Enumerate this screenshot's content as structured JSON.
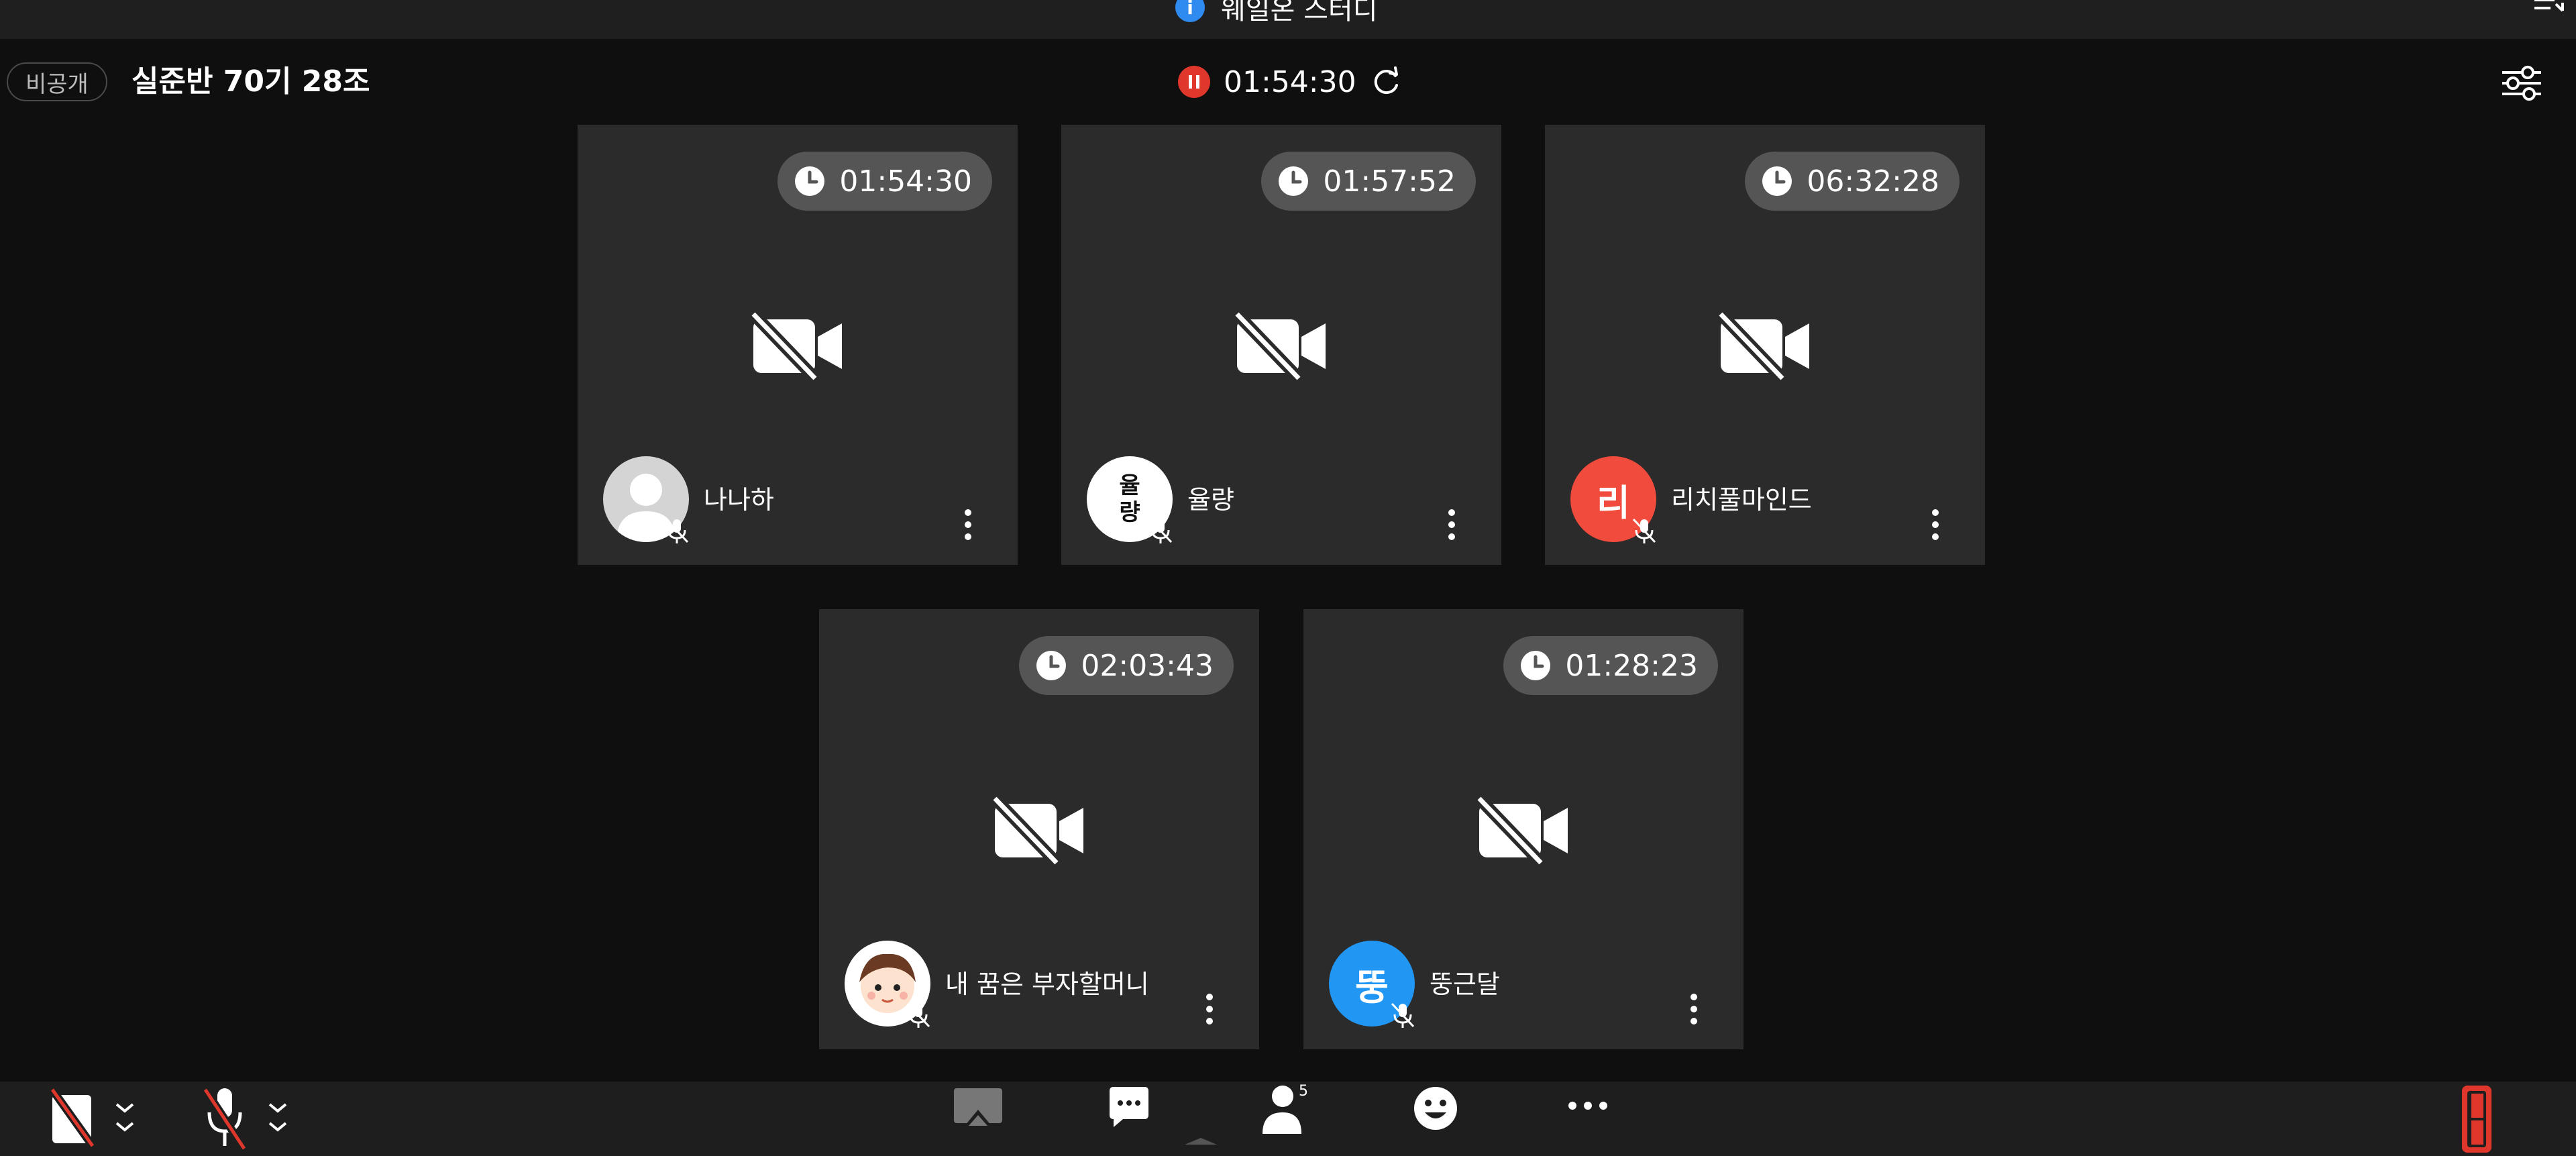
{
  "window": {
    "title": "웨일온 스터디",
    "info_icon": "i"
  },
  "header": {
    "privacy_label": "비공개",
    "room_title": "실준반 70기 28조",
    "session_time": "01:54:30",
    "colors": {
      "pause": "#e0372d"
    }
  },
  "participants": [
    {
      "name": "나나하",
      "timer": "01:54:30",
      "avatar_type": "silhouette",
      "avatar_color": "#c9c9c9"
    },
    {
      "name": "율량",
      "timer": "01:57:52",
      "avatar_type": "text",
      "avatar_text": "율량",
      "avatar_color": "#ffffff"
    },
    {
      "name": "리치풀마인드",
      "timer": "06:32:28",
      "avatar_type": "letter",
      "avatar_text": "리",
      "avatar_color": "#f04b3c"
    },
    {
      "name": "내 꿈은 부자할머니",
      "timer": "02:03:43",
      "avatar_type": "cartoon",
      "avatar_color": "#ffffff"
    },
    {
      "name": "뚱근달",
      "timer": "01:28:23",
      "avatar_type": "letter",
      "avatar_text": "뚱",
      "avatar_color": "#2196f3"
    }
  ],
  "toolbar": {
    "participants_count": "5",
    "icons": [
      "camera-off-icon",
      "mic-off-icon",
      "screen-share-icon",
      "chat-icon",
      "participants-icon",
      "emoji-icon",
      "more-icon",
      "exit-icon"
    ]
  }
}
